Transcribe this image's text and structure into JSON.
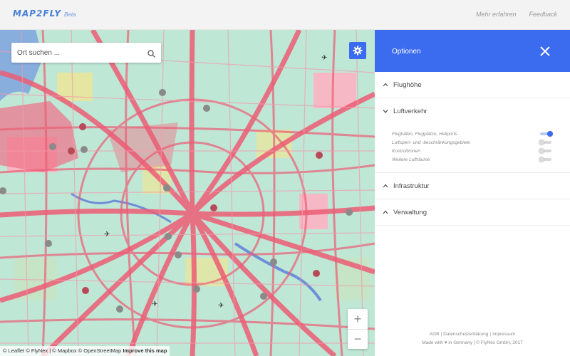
{
  "header": {
    "logo": "MAP2FLY",
    "logo_badge": "Beta",
    "nav": [
      "Mehr erfahren",
      "Feedback"
    ]
  },
  "map": {
    "search_placeholder": "Ort suchen ...",
    "attribution": {
      "text": "© Leaflet © FlyNex | © Mapbox © OpenStreetMap",
      "link": "Improve this map"
    },
    "zoom_in": "+",
    "zoom_out": "−"
  },
  "panel": {
    "title": "Optionen",
    "sections": [
      {
        "label": "Flughöhe",
        "expanded": false
      },
      {
        "label": "Luftverkehr",
        "expanded": true
      },
      {
        "label": "Infrastruktur",
        "expanded": false
      },
      {
        "label": "Verwaltung",
        "expanded": false
      }
    ],
    "luftverkehr_toggles": [
      {
        "label": "Flughäfen, Flugplätze, Heliports",
        "on": true
      },
      {
        "label": "Luftsperr- und -beschränkungsgebiete",
        "on": false
      },
      {
        "label": "Kontrollzonen",
        "on": false
      },
      {
        "label": "Weitere Lufträume",
        "on": false
      }
    ],
    "footer": {
      "links": [
        "AGB",
        "Datenschutzerklärung",
        "Impressum"
      ],
      "made_with": "Made with ♥ in Germany | © FlyNex GmbH, 2017"
    }
  },
  "colors": {
    "accent": "#3b6cf0",
    "map_green": "#9fe3c9",
    "map_red": "#ec5d75"
  }
}
